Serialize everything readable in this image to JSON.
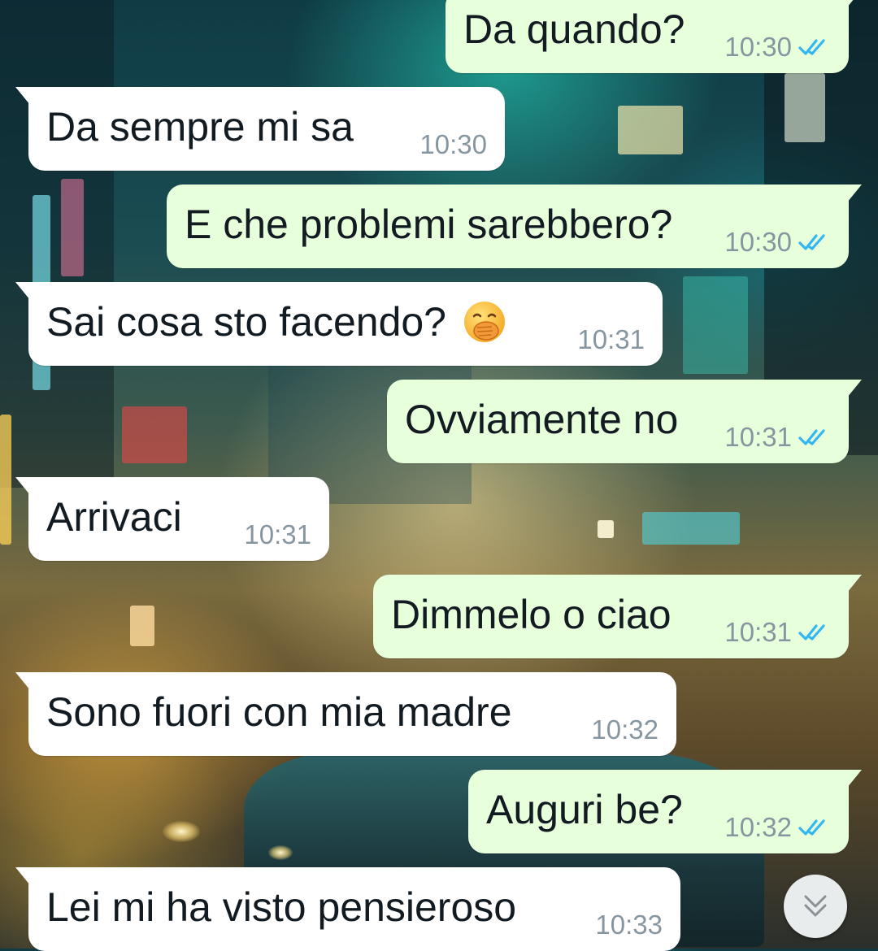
{
  "colors": {
    "incoming_bubble": "#ffffff",
    "outgoing_bubble": "#e7ffdb",
    "text": "#111b21",
    "timestamp": "#8696a0",
    "read_ticks": "#34b7f1"
  },
  "messages": [
    {
      "direction": "outgoing",
      "text": "Da quando?",
      "time": "10:30",
      "status": "read"
    },
    {
      "direction": "incoming",
      "text": "Da sempre mi sa",
      "time": "10:30"
    },
    {
      "direction": "outgoing",
      "text": "E che problemi sarebbero?",
      "time": "10:30",
      "status": "read"
    },
    {
      "direction": "incoming",
      "text": "Sai cosa sto facendo?",
      "time": "10:31",
      "emoji": "face-with-hand-over-mouth"
    },
    {
      "direction": "outgoing",
      "text": "Ovviamente no",
      "time": "10:31",
      "status": "read"
    },
    {
      "direction": "incoming",
      "text": "Arrivaci",
      "time": "10:31"
    },
    {
      "direction": "outgoing",
      "text": "Dimmelo o ciao",
      "time": "10:31",
      "status": "read"
    },
    {
      "direction": "incoming",
      "text": "Sono fuori con mia madre",
      "time": "10:32"
    },
    {
      "direction": "outgoing",
      "text": "Auguri be?",
      "time": "10:32",
      "status": "read"
    },
    {
      "direction": "incoming",
      "text": "Lei mi ha visto pensieroso",
      "time": "10:33"
    }
  ],
  "scroll_button": {
    "icon": "double-chevron-down-icon"
  }
}
